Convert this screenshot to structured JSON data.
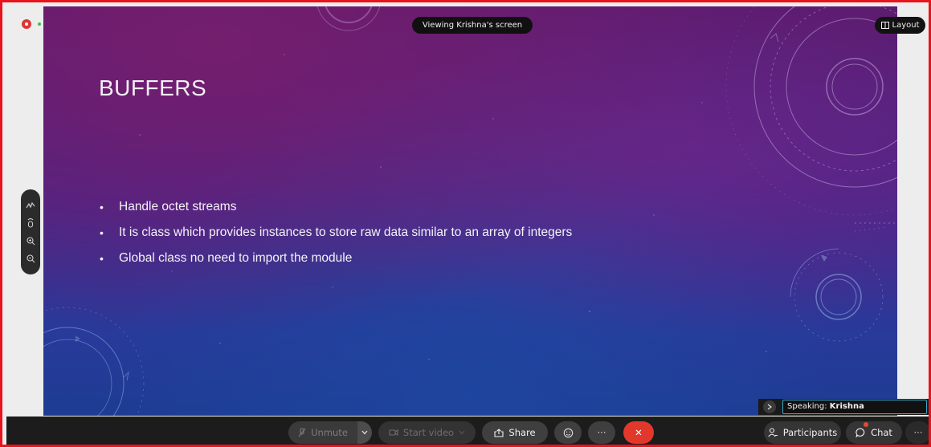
{
  "header": {
    "viewing_label": "Viewing Krishna's screen",
    "layout_label": "Layout"
  },
  "slide": {
    "title": "BUFFERS",
    "bullets": [
      "Handle octet streams",
      "It is class which provides instances to store raw data similar to an array of integers",
      "Global class no need to import the module"
    ]
  },
  "left_toolbar": {
    "items": [
      "annotate-icon",
      "pointer-icon",
      "zoom-in-icon",
      "zoom-out-icon"
    ]
  },
  "speaking": {
    "prefix": "Speaking:",
    "name": "Krishna"
  },
  "controls": {
    "unmute_label": "Unmute",
    "start_video_label": "Start video",
    "share_label": "Share",
    "more_label": "···",
    "end_label": "✕",
    "participants_label": "Participants",
    "chat_label": "Chat",
    "overflow_label": "···"
  },
  "colors": {
    "frame": "#e8141b",
    "end_call": "#e2382b",
    "bar_background": "#1c1c1c",
    "speaking_border": "#35a7c2"
  }
}
